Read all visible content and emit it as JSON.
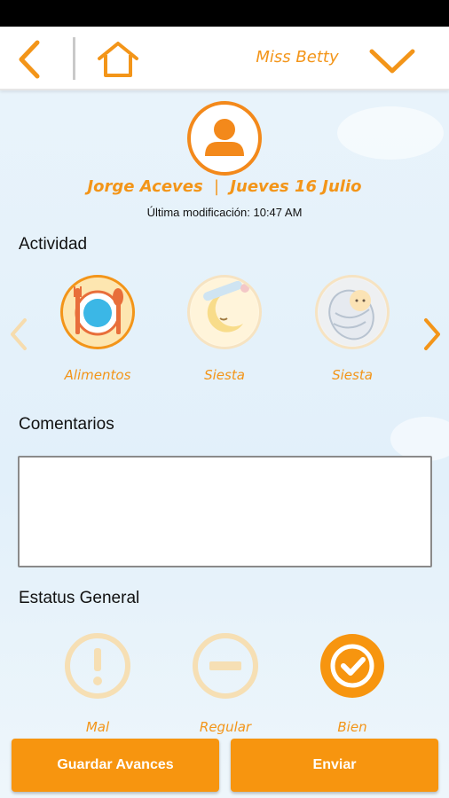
{
  "header": {
    "teacher_name": "Miss Betty"
  },
  "student": {
    "name": "Jorge Aceves",
    "separator": "|",
    "date": "Jueves 16 Julio",
    "last_modified": "Última modificación: 10:47 AM"
  },
  "activity": {
    "section_label": "Actividad",
    "items": [
      {
        "label": "Alimentos",
        "icon": "plate-cutlery-icon",
        "selected": true
      },
      {
        "label": "Siesta",
        "icon": "sleeping-moon-icon",
        "selected": false
      },
      {
        "label": "Siesta",
        "icon": "swaddled-baby-icon",
        "selected": false
      }
    ]
  },
  "comments": {
    "section_label": "Comentarios",
    "value": "",
    "placeholder": ""
  },
  "status": {
    "section_label": "Estatus General",
    "options": [
      {
        "label": "Mal",
        "icon": "exclamation-icon",
        "selected": false
      },
      {
        "label": "Regular",
        "icon": "minus-icon",
        "selected": false
      },
      {
        "label": "Bien",
        "icon": "checkmark-icon",
        "selected": true
      }
    ]
  },
  "buttons": {
    "save_label": "Guardar Avances",
    "send_label": "Enviar"
  },
  "colors": {
    "accent": "#f39519",
    "button": "#f7950f",
    "faded": "#f6dfb4"
  }
}
